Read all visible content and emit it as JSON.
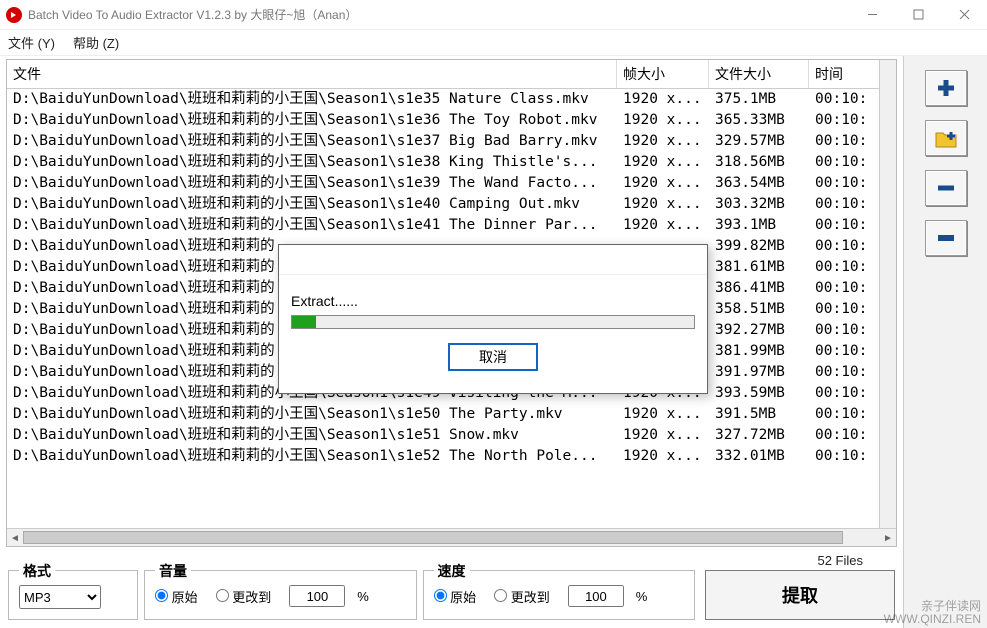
{
  "window": {
    "title": "Batch Video To Audio Extractor V1.2.3 by 大眼仔~旭（Anan）"
  },
  "menu": {
    "file": "文件 (Y)",
    "help": "帮助 (Z)"
  },
  "columns": {
    "file": "文件",
    "frame": "帧大小",
    "size": "文件大小",
    "time": "时间"
  },
  "rows": [
    {
      "file": "D:\\BaiduYunDownload\\班班和莉莉的小王国\\Season1\\s1e35 Nature Class.mkv",
      "frame": "1920 x...",
      "size": "375.1MB",
      "time": "00:10:"
    },
    {
      "file": "D:\\BaiduYunDownload\\班班和莉莉的小王国\\Season1\\s1e36 The Toy Robot.mkv",
      "frame": "1920 x...",
      "size": "365.33MB",
      "time": "00:10:"
    },
    {
      "file": "D:\\BaiduYunDownload\\班班和莉莉的小王国\\Season1\\s1e37 Big Bad Barry.mkv",
      "frame": "1920 x...",
      "size": "329.57MB",
      "time": "00:10:"
    },
    {
      "file": "D:\\BaiduYunDownload\\班班和莉莉的小王国\\Season1\\s1e38 King Thistle's...",
      "frame": "1920 x...",
      "size": "318.56MB",
      "time": "00:10:"
    },
    {
      "file": "D:\\BaiduYunDownload\\班班和莉莉的小王国\\Season1\\s1e39 The Wand Facto...",
      "frame": "1920 x...",
      "size": "363.54MB",
      "time": "00:10:"
    },
    {
      "file": "D:\\BaiduYunDownload\\班班和莉莉的小王国\\Season1\\s1e40 Camping Out.mkv",
      "frame": "1920 x...",
      "size": "303.32MB",
      "time": "00:10:"
    },
    {
      "file": "D:\\BaiduYunDownload\\班班和莉莉的小王国\\Season1\\s1e41 The Dinner Par...",
      "frame": "1920 x...",
      "size": "393.1MB",
      "time": "00:10:"
    },
    {
      "file": "D:\\BaiduYunDownload\\班班和莉莉的",
      "frame": "",
      "size": "399.82MB",
      "time": "00:10:"
    },
    {
      "file": "D:\\BaiduYunDownload\\班班和莉莉的",
      "frame": "",
      "size": "381.61MB",
      "time": "00:10:"
    },
    {
      "file": "D:\\BaiduYunDownload\\班班和莉莉的",
      "frame": "",
      "size": "386.41MB",
      "time": "00:10:"
    },
    {
      "file": "D:\\BaiduYunDownload\\班班和莉莉的",
      "frame": "",
      "size": "358.51MB",
      "time": "00:10:"
    },
    {
      "file": "D:\\BaiduYunDownload\\班班和莉莉的",
      "frame": "",
      "size": "392.27MB",
      "time": "00:10:"
    },
    {
      "file": "D:\\BaiduYunDownload\\班班和莉莉的",
      "frame": "",
      "size": "381.99MB",
      "time": "00:10:"
    },
    {
      "file": "D:\\BaiduYunDownload\\班班和莉莉的",
      "frame": "",
      "size": "391.97MB",
      "time": "00:10:"
    },
    {
      "file": "D:\\BaiduYunDownload\\班班和莉莉的小王国\\Season1\\s1e49 Visiting the M...",
      "frame": "1920 x...",
      "size": "393.59MB",
      "time": "00:10:"
    },
    {
      "file": "D:\\BaiduYunDownload\\班班和莉莉的小王国\\Season1\\s1e50 The Party.mkv",
      "frame": "1920 x...",
      "size": "391.5MB",
      "time": "00:10:"
    },
    {
      "file": "D:\\BaiduYunDownload\\班班和莉莉的小王国\\Season1\\s1e51 Snow.mkv",
      "frame": "1920 x...",
      "size": "327.72MB",
      "time": "00:10:"
    },
    {
      "file": "D:\\BaiduYunDownload\\班班和莉莉的小王国\\Season1\\s1e52 The North Pole...",
      "frame": "1920 x...",
      "size": "332.01MB",
      "time": "00:10:"
    }
  ],
  "status": {
    "file_count": "52 Files"
  },
  "groups": {
    "format": {
      "legend": "格式",
      "selected": "MP3"
    },
    "volume": {
      "legend": "音量",
      "opt1": "原始",
      "opt2": "更改到",
      "value": "100",
      "suffix": "%"
    },
    "speed": {
      "legend": "速度",
      "opt1": "原始",
      "opt2": "更改到",
      "value": "100",
      "suffix": "%"
    }
  },
  "buttons": {
    "extract": "提取"
  },
  "modal": {
    "label": "Extract......",
    "cancel": "取消"
  },
  "watermark": {
    "line1": "亲子伴读网",
    "line2": "WWW.QINZI.REN"
  }
}
